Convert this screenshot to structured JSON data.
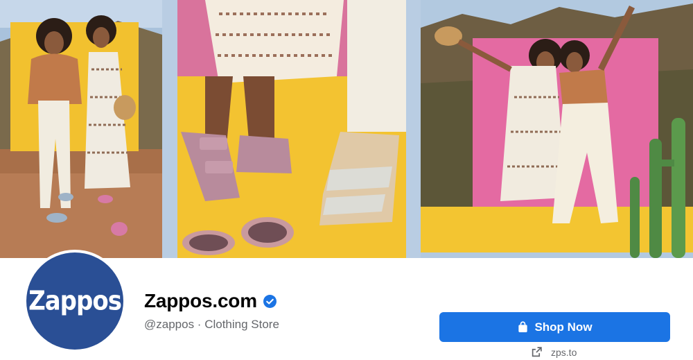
{
  "page": {
    "name": "Zappos.com",
    "verified": true,
    "handle": "@zappos",
    "separator": " · ",
    "category": "Clothing Store"
  },
  "avatar": {
    "logo_text": "Zappos",
    "background": "#2a4f95"
  },
  "cta": {
    "label": "Shop Now",
    "icon": "shopping-bag-icon",
    "color": "#1b74e4"
  },
  "website": {
    "text": "zps.to",
    "icon": "external-link-icon"
  },
  "cover": {
    "panels": [
      "two-women-on-yellow-backdrop",
      "sandals-and-sunglasses-closeup",
      "women-pink-backdrop-with-cactus"
    ]
  },
  "colors": {
    "yellow": "#f2c230",
    "pink": "#e06aa0",
    "verified": "#1b74e4"
  }
}
